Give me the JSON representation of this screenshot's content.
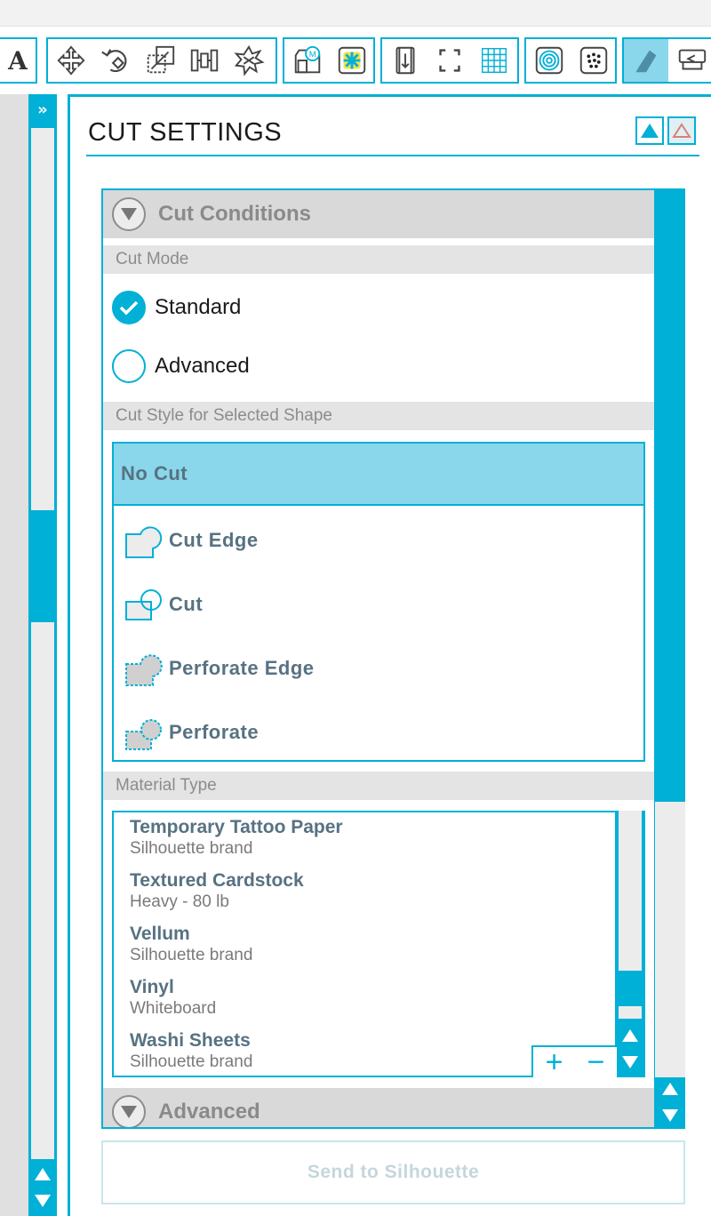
{
  "toolbar": {
    "text_tool_label": "A",
    "groups": [
      {
        "name": "text",
        "icons": [
          "text-icon"
        ]
      },
      {
        "name": "transform",
        "icons": [
          "move-icon",
          "rotate-icon",
          "scale-icon",
          "align-icon",
          "replicate-icon"
        ]
      },
      {
        "name": "library",
        "icons": [
          "design-store-icon",
          "fill-icon"
        ]
      },
      {
        "name": "page",
        "icons": [
          "page-setup-icon",
          "registration-marks-icon",
          "grid-icon"
        ]
      },
      {
        "name": "effects",
        "icons": [
          "offset-icon",
          "trace-icon"
        ]
      },
      {
        "name": "output",
        "icons": [
          "cut-settings-icon",
          "send-icon"
        ],
        "active": "cut-settings-icon"
      }
    ]
  },
  "left_panel": {
    "expand_label": "»"
  },
  "panel": {
    "title": "CUT SETTINGS",
    "sections": {
      "cut_conditions": {
        "title": "Cut Conditions",
        "cut_mode": {
          "label": "Cut Mode",
          "options": [
            {
              "label": "Standard",
              "selected": true
            },
            {
              "label": "Advanced",
              "selected": false
            }
          ]
        },
        "cut_style": {
          "label": "Cut Style for Selected Shape",
          "options": [
            {
              "label": "No Cut",
              "selected": true,
              "icon": "no-cut-icon"
            },
            {
              "label": "Cut Edge",
              "selected": false,
              "icon": "cut-edge-icon"
            },
            {
              "label": "Cut",
              "selected": false,
              "icon": "cut-icon"
            },
            {
              "label": "Perforate Edge",
              "selected": false,
              "icon": "perforate-edge-icon"
            },
            {
              "label": "Perforate",
              "selected": false,
              "icon": "perforate-icon"
            }
          ]
        },
        "material_type": {
          "label": "Material Type",
          "items": [
            {
              "name": "Temporary Tattoo Paper",
              "detail": "Silhouette brand"
            },
            {
              "name": "Textured Cardstock",
              "detail": "Heavy - 80 lb"
            },
            {
              "name": "Vellum",
              "detail": "Silhouette brand"
            },
            {
              "name": "Vinyl",
              "detail": "Whiteboard"
            },
            {
              "name": "Washi Sheets",
              "detail": "Silhouette brand"
            }
          ],
          "add_label": "+",
          "remove_label": "−"
        }
      },
      "advanced": {
        "title": "Advanced"
      }
    },
    "send_button": "Send to Silhouette"
  },
  "colors": {
    "accent": "#00b0d6",
    "selected_row": "#8ad6ea",
    "section_header": "#d9d9d9",
    "label_text": "#577282",
    "disabled_text": "#c5d6dc"
  }
}
